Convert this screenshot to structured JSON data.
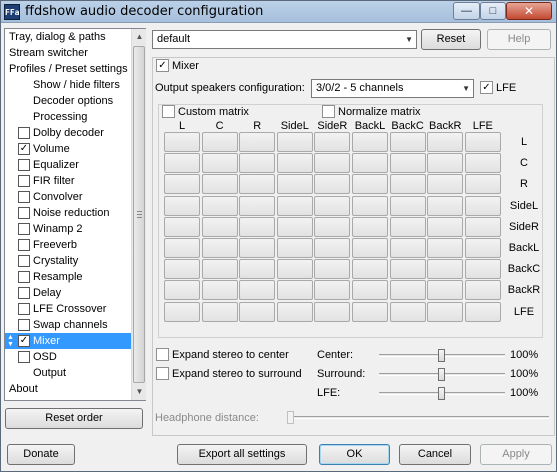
{
  "window": {
    "title": "ffdshow audio decoder configuration",
    "icon_label": "FFa",
    "minimize_icon": "minimize-icon",
    "maximize_icon": "maximize-icon",
    "close_icon": "close-icon"
  },
  "sidebar": {
    "items": [
      {
        "label": "Tray, dialog & paths",
        "indent": 0,
        "checkbox": false
      },
      {
        "label": "Stream switcher",
        "indent": 0,
        "checkbox": false
      },
      {
        "label": "Profiles / Preset settings",
        "indent": 0,
        "checkbox": false
      },
      {
        "label": "Show / hide filters",
        "indent": 1,
        "checkbox": false
      },
      {
        "label": "Decoder options",
        "indent": 1,
        "checkbox": false
      },
      {
        "label": "Processing",
        "indent": 1,
        "checkbox": false
      },
      {
        "label": "Dolby decoder",
        "indent": 1,
        "checkbox": true,
        "checked": false
      },
      {
        "label": "Volume",
        "indent": 1,
        "checkbox": true,
        "checked": true
      },
      {
        "label": "Equalizer",
        "indent": 1,
        "checkbox": true,
        "checked": false
      },
      {
        "label": "FIR filter",
        "indent": 1,
        "checkbox": true,
        "checked": false
      },
      {
        "label": "Convolver",
        "indent": 1,
        "checkbox": true,
        "checked": false
      },
      {
        "label": "Noise reduction",
        "indent": 1,
        "checkbox": true,
        "checked": false
      },
      {
        "label": "Winamp 2",
        "indent": 1,
        "checkbox": true,
        "checked": false
      },
      {
        "label": "Freeverb",
        "indent": 1,
        "checkbox": true,
        "checked": false
      },
      {
        "label": "Crystality",
        "indent": 1,
        "checkbox": true,
        "checked": false
      },
      {
        "label": "Resample",
        "indent": 1,
        "checkbox": true,
        "checked": false
      },
      {
        "label": "Delay",
        "indent": 1,
        "checkbox": true,
        "checked": false
      },
      {
        "label": "LFE Crossover",
        "indent": 1,
        "checkbox": true,
        "checked": false
      },
      {
        "label": "Swap channels",
        "indent": 1,
        "checkbox": true,
        "checked": false
      },
      {
        "label": "Mixer",
        "indent": 1,
        "checkbox": true,
        "checked": true,
        "selected": true
      },
      {
        "label": "OSD",
        "indent": 1,
        "checkbox": true,
        "checked": false
      },
      {
        "label": "Output",
        "indent": 1,
        "checkbox": false
      },
      {
        "label": "About",
        "indent": 0,
        "checkbox": false
      }
    ],
    "reset_order_label": "Reset order"
  },
  "toolbar": {
    "preset_value": "default",
    "reset_label": "Reset",
    "help_label": "Help"
  },
  "mixer": {
    "enable_label": "Mixer",
    "enabled": true,
    "output_config_label": "Output speakers configuration:",
    "output_config_value": "3/0/2 - 5 channels",
    "lfe_label": "LFE",
    "lfe_checked": true,
    "custom_matrix_label": "Custom matrix",
    "custom_matrix_checked": false,
    "normalize_matrix_label": "Normalize matrix",
    "normalize_matrix_checked": false,
    "columns": [
      "L",
      "C",
      "R",
      "SideL",
      "SideR",
      "BackL",
      "BackC",
      "BackR",
      "LFE"
    ],
    "rows": [
      "L",
      "C",
      "R",
      "SideL",
      "SideR",
      "BackL",
      "BackC",
      "BackR",
      "LFE"
    ],
    "expand_center_label": "Expand stereo to center",
    "expand_surround_label": "Expand stereo to surround",
    "sliders": [
      {
        "label": "Center:",
        "value_text": "100%",
        "position": 0.5
      },
      {
        "label": "Surround:",
        "value_text": "100%",
        "position": 0.5
      },
      {
        "label": "LFE:",
        "value_text": "100%",
        "position": 0.5
      }
    ],
    "headphone_label": "Headphone distance:",
    "headphone_position": 0.0
  },
  "footer": {
    "donate_label": "Donate",
    "export_label": "Export all settings",
    "ok_label": "OK",
    "cancel_label": "Cancel",
    "apply_label": "Apply"
  }
}
